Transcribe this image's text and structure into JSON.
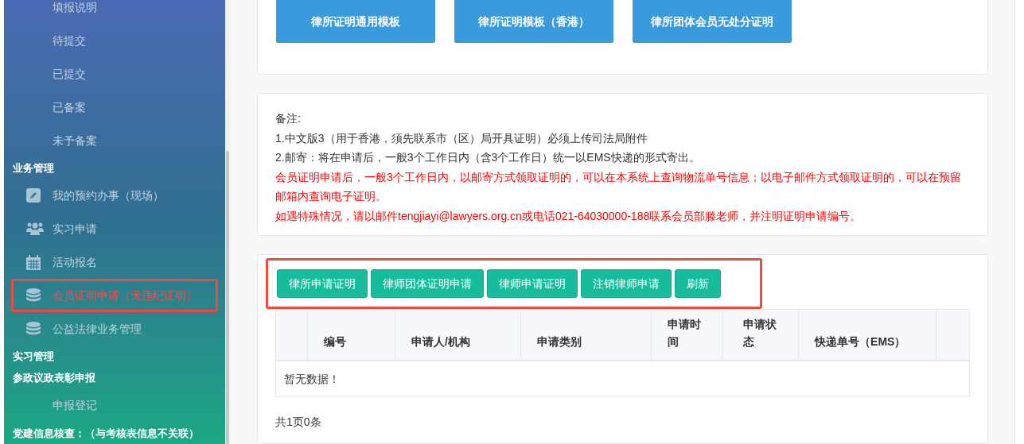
{
  "sidebar": {
    "items": [
      {
        "kind": "subitem",
        "label": "填报说明",
        "selected": false,
        "highlighted": false
      },
      {
        "kind": "subitem",
        "label": "待提交",
        "selected": false,
        "highlighted": false
      },
      {
        "kind": "subitem",
        "label": "已提交",
        "selected": false,
        "highlighted": false
      },
      {
        "kind": "subitem",
        "label": "已备案",
        "selected": false,
        "highlighted": false
      },
      {
        "kind": "subitem",
        "label": "未予备案",
        "selected": false,
        "highlighted": false
      },
      {
        "kind": "header",
        "label": "业务管理"
      },
      {
        "kind": "iconitem",
        "label": "我的预约办事（现场）",
        "selected": false,
        "highlighted": false
      },
      {
        "kind": "iconitem",
        "label": "实习申请",
        "selected": false,
        "highlighted": false
      },
      {
        "kind": "iconitem",
        "label": "活动报名",
        "selected": false,
        "highlighted": false
      },
      {
        "kind": "iconitem",
        "label": "会员证明申请（无违纪证明）",
        "selected": true,
        "highlighted": true
      },
      {
        "kind": "iconitem",
        "label": "公益法律业务管理",
        "selected": false,
        "highlighted": false
      },
      {
        "kind": "header",
        "label": "实习管理"
      },
      {
        "kind": "header",
        "label": "参政议政表彰申报"
      },
      {
        "kind": "subitem",
        "label": "申报登记",
        "selected": false,
        "highlighted": false
      },
      {
        "kind": "header",
        "label": "党建信息核查：（与考核表信息不关联）"
      }
    ]
  },
  "templates": {
    "buttons": [
      "律所证明通用模板",
      "律所证明模板（香港）",
      "律所团体会员无处分证明"
    ]
  },
  "notes": {
    "lines": [
      {
        "kind": "normal",
        "text": "备注:"
      },
      {
        "kind": "normal",
        "text": "1.中文版3（用于香港，须先联系市（区）局开具证明）必须上传司法局附件"
      },
      {
        "kind": "normal",
        "text": "2.邮寄：将在申请后，一般3个工作日内（含3个工作日）统一以EMS快递的形式寄出。"
      },
      {
        "kind": "warning",
        "text": "会员证明申请后，一般3个工作日内，以邮寄方式领取证明的，可以在本系统上查询物流单号信息；以电子邮件方式领取证明的，可以在预留邮箱内查询电子证明。"
      },
      {
        "kind": "warning",
        "text": "如遇特殊情况，请以邮件tengjiayi@lawyers.org.cn或电话021-64030000-188联系会员部滕老师，并注明证明申请编号。"
      }
    ]
  },
  "applications": {
    "toolbar": {
      "highlighted": true,
      "buttons": [
        "律所申请证明",
        "律师团体证明申请",
        "律师申请证明",
        "注销律师申请",
        "刷新"
      ]
    },
    "table": {
      "columns": [
        "编号",
        "申请人/机构",
        "申请类别",
        "申请时间",
        "申请状态",
        "快递单号（EMS）"
      ],
      "empty_text": "暂无数据！"
    },
    "footer": "共1页0条"
  }
}
